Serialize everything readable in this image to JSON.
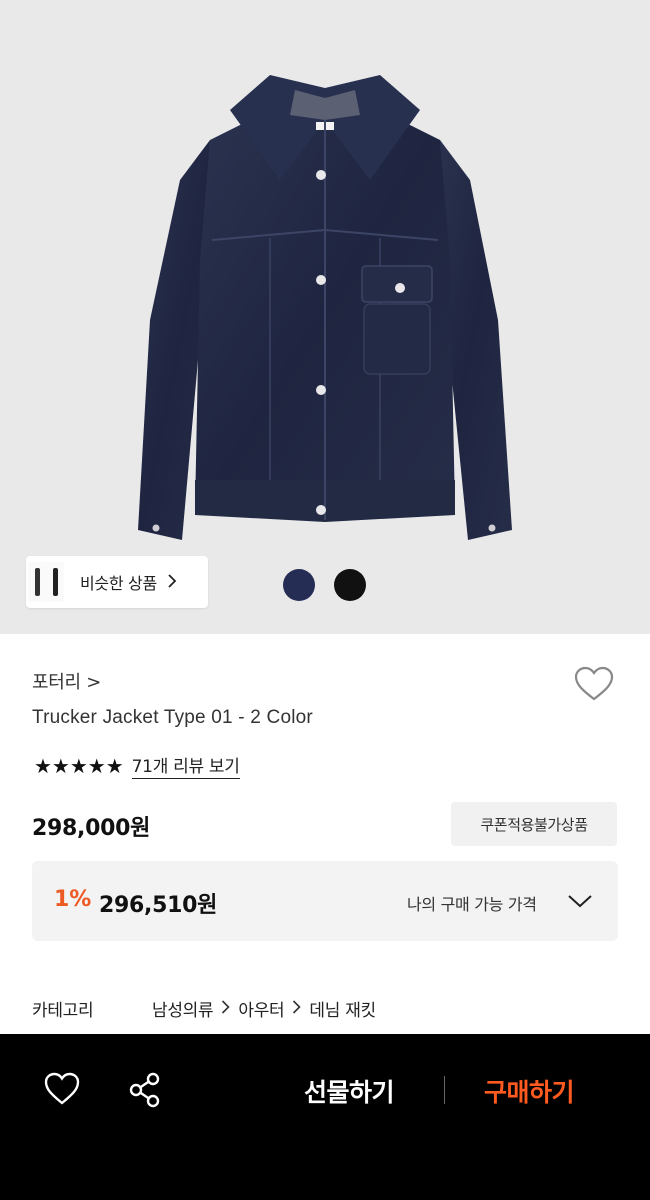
{
  "hero": {
    "image_icon": "denim-jacket-product-image",
    "similar_label": "비슷한 상품",
    "swatches": [
      {
        "name": "navy",
        "color": "#252d55"
      },
      {
        "name": "black",
        "color": "#111111"
      }
    ]
  },
  "product": {
    "brand": "포터리 >",
    "title": "Trucker Jacket Type 01 - 2 Color",
    "stars": "★★★★★",
    "review_link": "71개 리뷰 보기",
    "price": "298,000원",
    "coupon_badge": "쿠폰적용불가상품"
  },
  "my_price": {
    "discount": "1%",
    "price": "296,510원",
    "label": "나의 구매 가능 가격"
  },
  "category": {
    "key": "카테고리",
    "path": [
      "남성의류",
      "아우터",
      "데님 재킷"
    ]
  },
  "bottom_bar": {
    "gift_label": "선물하기",
    "buy_label": "구매하기",
    "colors": {
      "accent": "#ff5a1f",
      "discount": "#ee5a24"
    }
  }
}
